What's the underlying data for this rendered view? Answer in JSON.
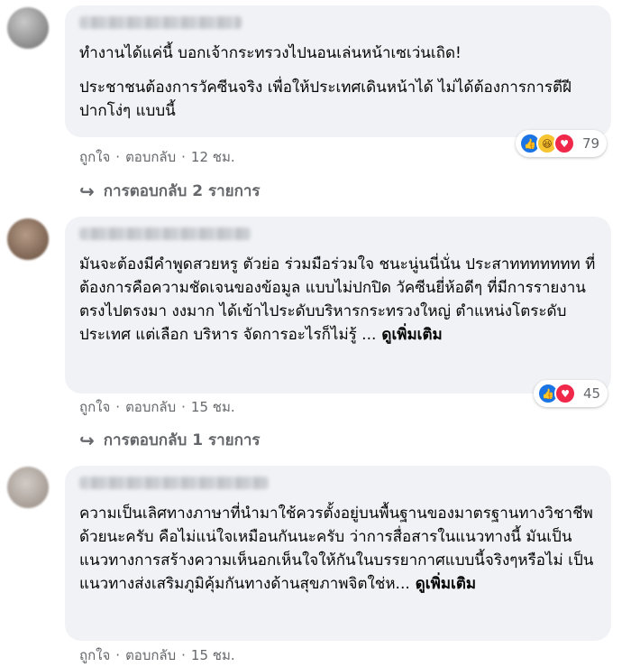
{
  "comments": [
    {
      "paragraphs": [
        "ทำงานได้แค่นี้ บอกเจ้ากระทรวงไปนอนเล่นหน้าเซเว่นเถิด!",
        "ประชาชนต้องการวัคซีนจริง เพื่อให้ประเทศเดินหน้าได้ ไม่ได้ต้องการการตีฝีปากโง่ๆ แบบนี้"
      ],
      "see_more": "",
      "reactions": {
        "icons": [
          "like-icon",
          "haha-icon",
          "care-icon"
        ],
        "count": "79"
      },
      "actions": {
        "like": "ถูกใจ",
        "reply": "ตอบกลับ",
        "time": "12 ชม."
      },
      "replies_label": "การตอบกลับ 2 รายการ"
    },
    {
      "paragraphs": [
        "มันจะต้องมีคำพูดสวยหรู ตัวย่อ ร่วมมือร่วมใจ ชนะนู่นนี่นั่น ประสาททททททท ที่ต้องการคือความชัดเจนของข้อมูล แบบไม่ปกปิด วัคซีนยี่ห้อดีๆ ที่มีการรายงาน ตรงไปตรงมา งงมาก ได้เข้าไประดับบริหารกระทรวงใหญ่ ตำแหน่งโตระดับประเทศ แต่เลือก บริหาร จัดการอะไรก็ไม่รู้ ..."
      ],
      "see_more": "ดูเพิ่มเติม",
      "reactions": {
        "icons": [
          "like-icon",
          "care-icon"
        ],
        "count": "45"
      },
      "actions": {
        "like": "ถูกใจ",
        "reply": "ตอบกลับ",
        "time": "15 ชม."
      },
      "replies_label": "การตอบกลับ 1 รายการ"
    },
    {
      "paragraphs": [
        "ความเป็นเลิศทางภาษาที่นำมาใช้ควรตั้งอยู่บนพื้นฐานของมาตรฐานทางวิชาชีพด้วยนะครับ คือไม่แน่ใจเหมือนกันนะครับ ว่าการสื่อสารในแนวทางนี้ มันเป็นแนวทางการสร้างความเห็นอกเห็นใจให้กันในบรรยากาศแบบนี้จริงๆหรือไม่ เป็นแนวทางส่งเสริมภูมิคุ้มกันทางด้านสุขภาพจิตใช่ห..."
      ],
      "see_more": "ดูเพิ่มเติม",
      "actions": {
        "like": "ถูกใจ",
        "reply": "ตอบกลับ",
        "time": "15 ชม."
      }
    }
  ],
  "separator": "·",
  "colors": {
    "bubble": "#f0f2f5",
    "meta": "#65676b",
    "like": "#1b74e4",
    "care": "#f0284a",
    "haha": "#f7c531"
  }
}
